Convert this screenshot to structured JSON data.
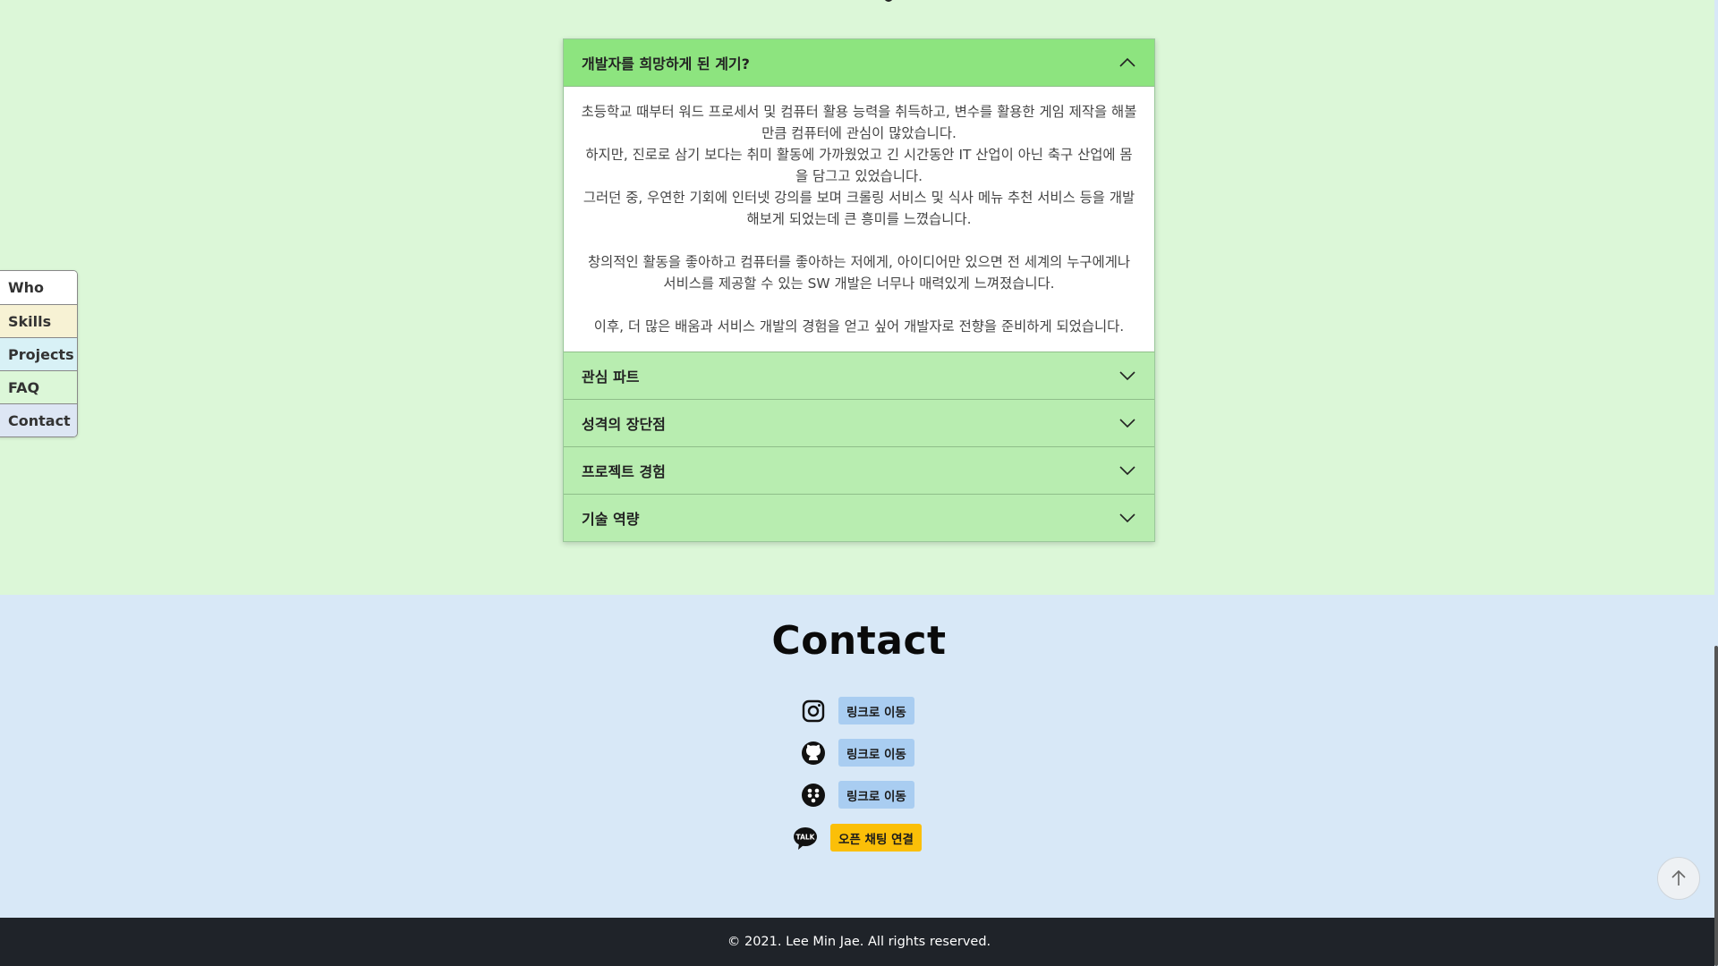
{
  "faq": {
    "items": [
      {
        "title": "개발자를 희망하게 된 계기?",
        "expanded": true,
        "body_lines": [
          "초등학교 때부터 워드 프로세서 및 컴퓨터 활용 능력을 취득하고, 변수를 활용한 게임 제작을 해볼만큼 컴퓨터에 관심이 많았습니다.",
          "하지만, 진로로 삼기 보다는 취미 활동에 가까웠었고 긴 시간동안 IT 산업이 아닌 축구 산업에 몸을 담그고 있었습니다.",
          "그러던 중, 우연한 기회에 인터넷 강의를 보며 크롤링 서비스 및 식사 메뉴 추천 서비스 등을 개발해보게 되었는데 큰 흥미를 느꼈습니다.",
          "",
          "창의적인 활동을 좋아하고 컴퓨터를 좋아하는 저에게, 아이디어만 있으면 전 세계의 누구에게나 서비스를 제공할 수 있는 SW 개발은 너무나 매력있게 느껴졌습니다.",
          "",
          "이후, 더 많은 배움과 서비스 개발의 경험을 얻고 싶어 개발자로 전향을 준비하게 되었습니다."
        ]
      },
      {
        "title": "관심 파트",
        "expanded": false
      },
      {
        "title": "성격의 장단점",
        "expanded": false
      },
      {
        "title": "프로젝트 경험",
        "expanded": false
      },
      {
        "title": "기술 역량",
        "expanded": false
      }
    ]
  },
  "side_nav": {
    "items": [
      "Who",
      "Skills",
      "Projects",
      "FAQ",
      "Contact"
    ]
  },
  "contact": {
    "title": "Contact",
    "links": [
      {
        "icon": "instagram-icon",
        "label": "링크로 이동"
      },
      {
        "icon": "github-icon",
        "label": "링크로 이동"
      },
      {
        "icon": "velog-icon",
        "label": "링크로 이동"
      },
      {
        "icon": "kakaotalk-icon",
        "label": "오픈 채팅 연결"
      }
    ]
  },
  "footer": {
    "copyright": "© 2021. Lee Min Jae. All rights reserved."
  },
  "colors": {
    "faq_bg": "#dcf7d8",
    "accordion_open": "#8de47f",
    "accordion_closed": "#b8edb0",
    "contact_bg": "#d8e8f7",
    "link_button": "#a9cdf1",
    "kakao_button": "#fbbf08",
    "footer_bg": "#1f2329"
  }
}
